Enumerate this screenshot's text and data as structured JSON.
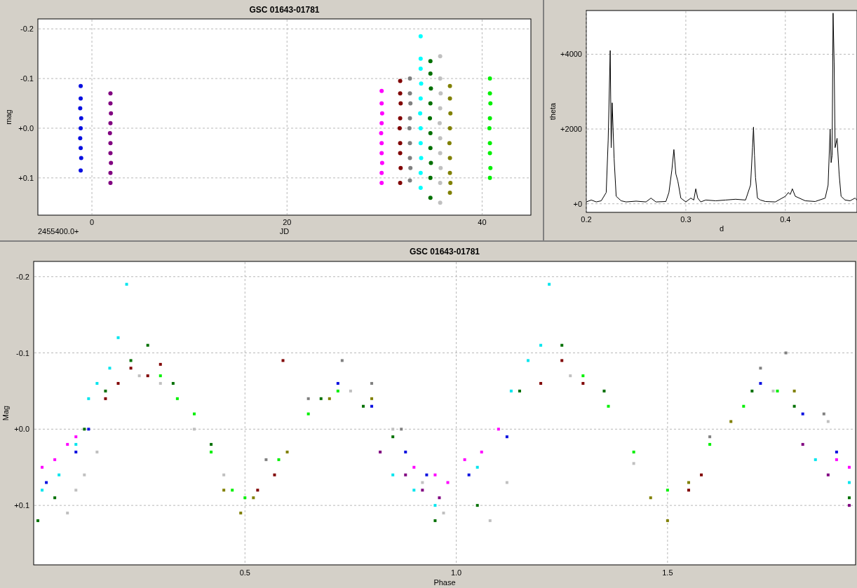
{
  "panels": [
    {
      "x_offset_label": "2455400.0+",
      "chart_data": {
        "type": "scatter",
        "title": "GSC 01643-01781",
        "xlabel": "JD",
        "ylabel": "mag",
        "grid": true,
        "xlim": [
          -5.54,
          45.0
        ],
        "ylim": [
          0.175,
          -0.22
        ],
        "xticks": [
          {
            "value": 0,
            "label": "0"
          },
          {
            "value": 20,
            "label": "20"
          },
          {
            "value": 40,
            "label": "40"
          }
        ],
        "yticks": [
          {
            "value": -0.2,
            "label": "-0.2"
          },
          {
            "value": -0.1,
            "label": "-0.1"
          },
          {
            "value": 0,
            "label": "+0.0"
          },
          {
            "value": 0.1,
            "label": "+0.1"
          }
        ],
        "series": [
          {
            "color": "#0a10e0",
            "x": [
              -1.15,
              -1.15,
              -1.2,
              -1.1,
              -1.15,
              -1.2,
              -1.15,
              -1.1,
              -1.15
            ],
            "values": [
              -0.085,
              -0.06,
              -0.04,
              -0.02,
              0.0,
              0.02,
              0.04,
              0.06,
              0.085
            ]
          },
          {
            "color": "#800080",
            "x": [
              1.9,
              1.9,
              1.95,
              1.9,
              1.85,
              1.9,
              1.9,
              1.95,
              1.9,
              1.9
            ],
            "values": [
              -0.07,
              -0.05,
              -0.03,
              -0.01,
              0.01,
              0.03,
              0.05,
              0.07,
              0.09,
              0.11
            ]
          },
          {
            "color": "#ff00ff",
            "x": [
              29.7,
              29.7,
              29.75,
              29.7,
              29.65,
              29.7,
              29.7,
              29.75,
              29.7,
              29.7
            ],
            "values": [
              -0.075,
              -0.05,
              -0.03,
              -0.01,
              0.01,
              0.03,
              0.05,
              0.07,
              0.09,
              0.11
            ]
          },
          {
            "color": "#800000",
            "x": [
              31.6,
              31.6,
              31.65,
              31.6,
              31.55,
              31.6,
              31.6,
              31.65,
              31.6
            ],
            "values": [
              -0.095,
              -0.07,
              -0.05,
              -0.02,
              0.0,
              0.03,
              0.05,
              0.08,
              0.11
            ]
          },
          {
            "color": "#808080",
            "x": [
              32.6,
              32.6,
              32.65,
              32.6,
              32.55,
              32.6,
              32.6,
              32.65,
              32.6
            ],
            "values": [
              -0.1,
              -0.07,
              -0.05,
              -0.02,
              0.0,
              0.03,
              0.06,
              0.08,
              0.105
            ]
          },
          {
            "color": "#00ffff",
            "x": [
              33.7,
              33.7,
              33.7,
              33.75,
              33.7,
              33.65,
              33.7,
              33.7,
              33.75,
              33.7,
              33.7
            ],
            "values": [
              -0.185,
              -0.14,
              -0.12,
              -0.09,
              -0.06,
              -0.03,
              0.0,
              0.03,
              0.06,
              0.09,
              0.12
            ]
          },
          {
            "color": "#007000",
            "x": [
              34.7,
              34.7,
              34.75,
              34.7,
              34.65,
              34.7,
              34.7,
              34.75,
              34.7,
              34.7
            ],
            "values": [
              -0.135,
              -0.11,
              -0.08,
              -0.05,
              -0.02,
              0.01,
              0.04,
              0.07,
              0.1,
              0.14
            ]
          },
          {
            "color": "#c0c0c0",
            "x": [
              35.7,
              35.7,
              35.75,
              35.7,
              35.65,
              35.7,
              35.7,
              35.75,
              35.7,
              35.7
            ],
            "values": [
              -0.145,
              -0.1,
              -0.07,
              -0.04,
              -0.01,
              0.02,
              0.05,
              0.08,
              0.11,
              0.15
            ]
          },
          {
            "color": "#808000",
            "x": [
              36.7,
              36.7,
              36.75,
              36.7,
              36.65,
              36.7,
              36.7,
              36.75,
              36.7
            ],
            "values": [
              -0.085,
              -0.06,
              -0.03,
              0.0,
              0.03,
              0.06,
              0.09,
              0.11,
              0.13
            ]
          },
          {
            "color": "#00f000",
            "x": [
              40.8,
              40.8,
              40.85,
              40.8,
              40.75,
              40.8,
              40.8,
              40.85,
              40.8
            ],
            "values": [
              -0.1,
              -0.07,
              -0.05,
              -0.02,
              0.0,
              0.03,
              0.05,
              0.08,
              0.1
            ]
          }
        ]
      }
    },
    {
      "chart_data": {
        "type": "line",
        "xlabel": "d",
        "ylabel": "theta",
        "grid": true,
        "xlim": [
          0.2,
          0.472
        ],
        "ylim": [
          -230,
          5170
        ],
        "xticks": [
          {
            "value": 0.2,
            "label": "0.2"
          },
          {
            "value": 0.3,
            "label": "0.3"
          },
          {
            "value": 0.4,
            "label": "0.4"
          }
        ],
        "yticks": [
          {
            "value": 0,
            "label": "+0"
          },
          {
            "value": 2000,
            "label": "+2000"
          },
          {
            "value": 4000,
            "label": "+4000"
          }
        ],
        "x": [
          0.2,
          0.205,
          0.21,
          0.215,
          0.22,
          0.222,
          0.224,
          0.225,
          0.226,
          0.228,
          0.23,
          0.235,
          0.24,
          0.25,
          0.26,
          0.265,
          0.27,
          0.28,
          0.283,
          0.286,
          0.288,
          0.29,
          0.292,
          0.295,
          0.3,
          0.305,
          0.308,
          0.31,
          0.312,
          0.315,
          0.32,
          0.33,
          0.34,
          0.35,
          0.36,
          0.365,
          0.367,
          0.368,
          0.369,
          0.37,
          0.372,
          0.375,
          0.38,
          0.39,
          0.4,
          0.403,
          0.405,
          0.407,
          0.41,
          0.42,
          0.43,
          0.44,
          0.443,
          0.445,
          0.446,
          0.447,
          0.448,
          0.449,
          0.45,
          0.452,
          0.454,
          0.456,
          0.46,
          0.465,
          0.47,
          0.472
        ],
        "series": [
          {
            "color": "#000000",
            "values": [
              50,
              100,
              50,
              80,
              300,
              1700,
              4100,
              1500,
              2700,
              1200,
              200,
              80,
              50,
              70,
              50,
              150,
              50,
              60,
              300,
              900,
              1450,
              800,
              600,
              150,
              50,
              150,
              100,
              400,
              150,
              50,
              100,
              80,
              100,
              120,
              100,
              500,
              1500,
              2050,
              1300,
              700,
              150,
              100,
              60,
              50,
              200,
              300,
              250,
              400,
              200,
              80,
              60,
              150,
              500,
              2000,
              1100,
              1300,
              5100,
              3800,
              1500,
              1750,
              800,
              200,
              100,
              80,
              150,
              100
            ]
          }
        ]
      }
    },
    {
      "chart_data": {
        "type": "scatter",
        "title": "GSC 01643-01781",
        "xlabel": "Phase",
        "ylabel": "Mag",
        "grid": true,
        "xlim": [
          0.0,
          1.945
        ],
        "ylim": [
          0.178,
          -0.22
        ],
        "xticks": [
          {
            "value": 0.5,
            "label": "0.5"
          },
          {
            "value": 1.0,
            "label": "1.0"
          },
          {
            "value": 1.5,
            "label": "1.5"
          }
        ],
        "yticks": [
          {
            "value": -0.2,
            "label": "-0.2"
          },
          {
            "value": -0.1,
            "label": "-0.1"
          },
          {
            "value": 0,
            "label": "+0.0"
          },
          {
            "value": 0.1,
            "label": "+0.1"
          }
        ],
        "series": [
          {
            "color": "#00e5ee",
            "x": [
              0.02,
              0.06,
              0.1,
              0.13,
              0.15,
              0.18,
              0.2,
              0.22,
              0.85,
              0.9,
              0.95,
              1.05,
              1.13,
              1.17,
              1.2,
              1.22,
              1.85,
              1.93
            ],
            "values": [
              0.08,
              0.06,
              0.02,
              -0.04,
              -0.06,
              -0.08,
              -0.12,
              -0.19,
              0.06,
              0.08,
              0.1,
              0.05,
              -0.05,
              -0.09,
              -0.11,
              -0.19,
              0.04,
              0.07
            ]
          },
          {
            "color": "#ff00ff",
            "x": [
              0.02,
              0.05,
              0.08,
              0.1,
              0.9,
              0.95,
              0.98,
              1.02,
              1.06,
              1.1,
              1.9,
              1.93
            ],
            "values": [
              0.05,
              0.04,
              0.02,
              0.01,
              0.05,
              0.06,
              0.07,
              0.04,
              0.03,
              0.0,
              0.04,
              0.05
            ]
          },
          {
            "color": "#0a10e0",
            "x": [
              0.03,
              0.1,
              0.13,
              0.72,
              0.8,
              0.88,
              0.93,
              1.03,
              1.12,
              1.72,
              1.82,
              1.9
            ],
            "values": [
              0.07,
              0.03,
              0.0,
              -0.06,
              -0.03,
              0.03,
              0.06,
              0.06,
              0.01,
              -0.06,
              -0.02,
              0.03
            ]
          },
          {
            "color": "#c0c0c0",
            "x": [
              0.08,
              0.1,
              0.12,
              0.15,
              0.25,
              0.3,
              0.38,
              0.45,
              0.75,
              0.85,
              0.92,
              0.97,
              1.08,
              1.12,
              1.27,
              1.42,
              1.75,
              1.88
            ],
            "values": [
              0.11,
              0.08,
              0.06,
              0.03,
              -0.07,
              -0.06,
              0.0,
              0.06,
              -0.05,
              0.0,
              0.07,
              0.11,
              0.12,
              0.07,
              -0.07,
              0.045,
              -0.05,
              -0.01
            ]
          },
          {
            "color": "#007000",
            "x": [
              0.01,
              0.05,
              0.12,
              0.17,
              0.23,
              0.27,
              0.33,
              0.42,
              0.68,
              0.78,
              0.85,
              0.95,
              1.05,
              1.15,
              1.25,
              1.35,
              1.7,
              1.8,
              1.93
            ],
            "values": [
              0.12,
              0.09,
              0.0,
              -0.05,
              -0.09,
              -0.11,
              -0.06,
              0.02,
              -0.04,
              -0.03,
              0.01,
              0.12,
              0.1,
              -0.05,
              -0.11,
              -0.05,
              -0.05,
              -0.03,
              0.09
            ]
          },
          {
            "color": "#800000",
            "x": [
              0.17,
              0.2,
              0.23,
              0.27,
              0.3,
              0.53,
              0.57,
              0.59,
              1.2,
              1.25,
              1.3,
              1.55,
              1.58
            ],
            "values": [
              -0.04,
              -0.06,
              -0.08,
              -0.07,
              -0.085,
              0.08,
              0.06,
              -0.09,
              -0.06,
              -0.09,
              -0.06,
              0.08,
              0.06
            ]
          },
          {
            "color": "#00f000",
            "x": [
              0.3,
              0.34,
              0.38,
              0.42,
              0.47,
              0.5,
              0.58,
              0.65,
              0.72,
              1.3,
              1.36,
              1.42,
              1.5,
              1.6,
              1.68,
              1.76
            ],
            "values": [
              -0.07,
              -0.04,
              -0.02,
              0.03,
              0.08,
              0.09,
              0.04,
              -0.02,
              -0.05,
              -0.07,
              -0.03,
              0.03,
              0.08,
              0.02,
              -0.03,
              -0.05
            ]
          },
          {
            "color": "#808000",
            "x": [
              0.45,
              0.49,
              0.52,
              0.6,
              0.7,
              0.8,
              1.46,
              1.5,
              1.55,
              1.65,
              1.8
            ],
            "values": [
              0.08,
              0.11,
              0.09,
              0.03,
              -0.04,
              -0.04,
              0.09,
              0.12,
              0.07,
              -0.01,
              -0.05
            ]
          },
          {
            "color": "#808080",
            "x": [
              0.55,
              0.65,
              0.73,
              0.8,
              0.87,
              1.6,
              1.72,
              1.78,
              1.87
            ],
            "values": [
              0.04,
              -0.04,
              -0.09,
              -0.06,
              0.0,
              0.01,
              -0.08,
              -0.1,
              -0.02
            ]
          },
          {
            "color": "#800080",
            "x": [
              0.82,
              0.88,
              0.92,
              0.96,
              1.82,
              1.88,
              1.93
            ],
            "values": [
              0.03,
              0.06,
              0.08,
              0.09,
              0.02,
              0.06,
              0.1
            ]
          }
        ]
      }
    }
  ]
}
